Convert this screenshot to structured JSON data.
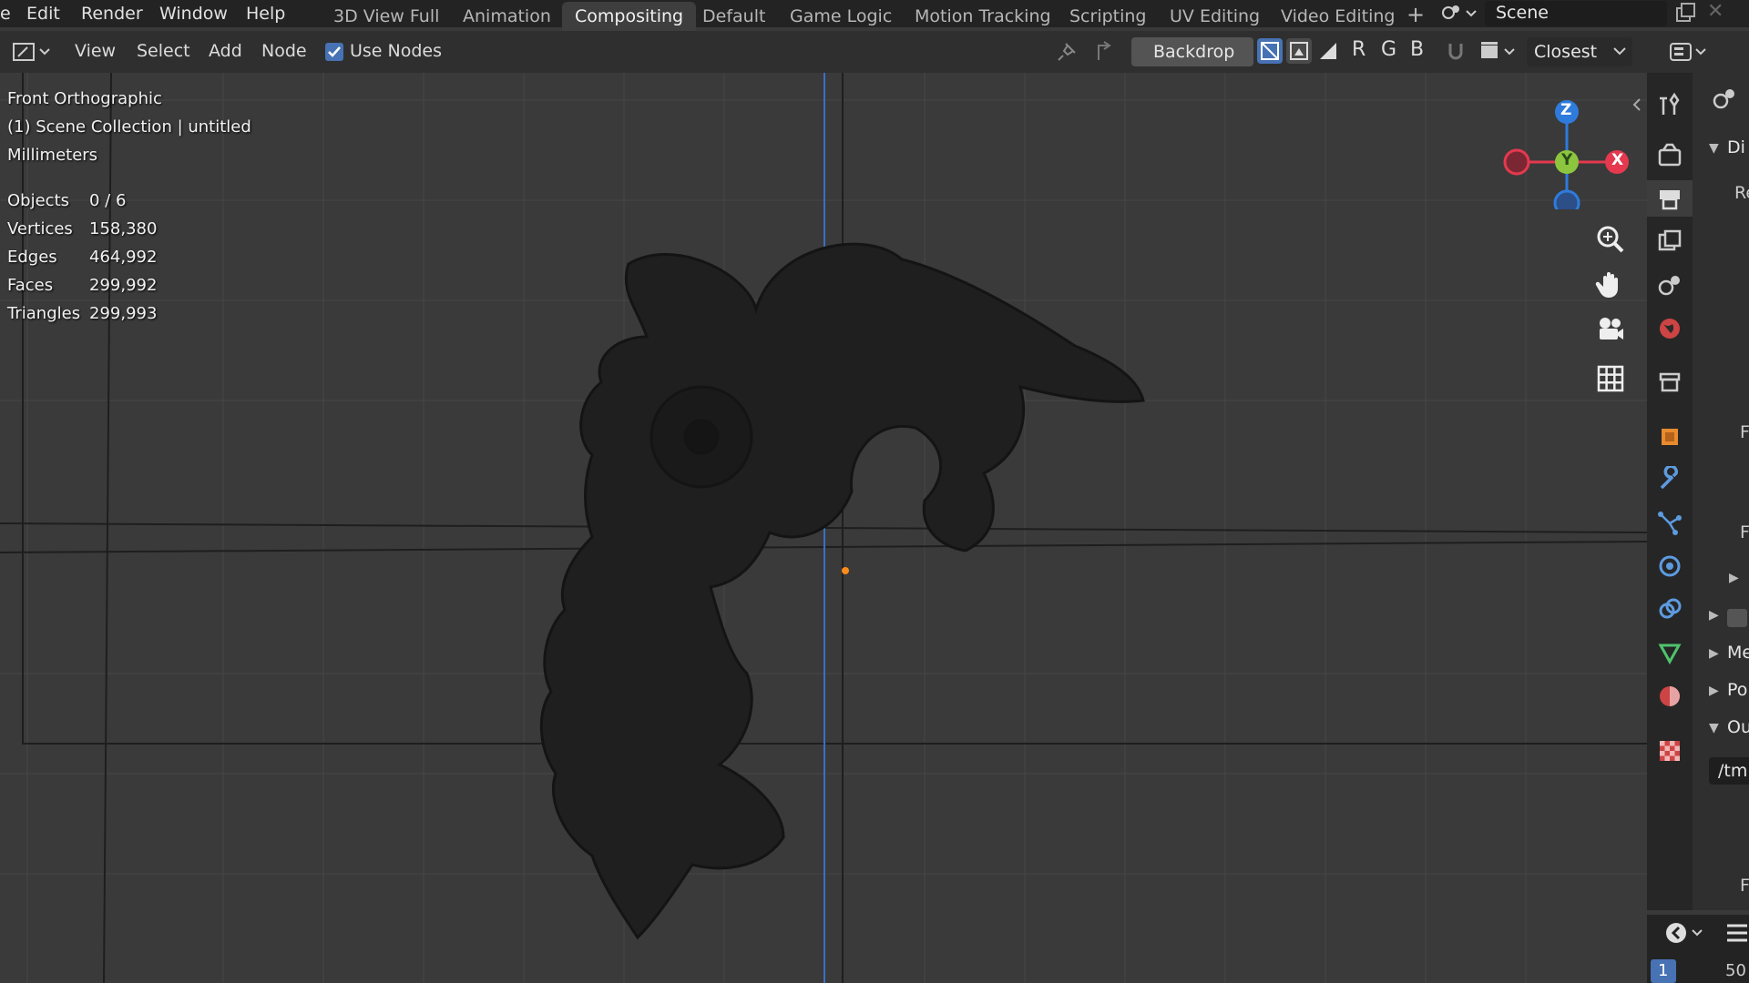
{
  "menu": {
    "edit": "Edit",
    "render": "Render",
    "window": "Window",
    "help": "Help"
  },
  "workspaces": [
    "3D View Full",
    "Animation",
    "Compositing",
    "Default",
    "Game Logic",
    "Motion Tracking",
    "Scripting",
    "UV Editing",
    "Video Editing"
  ],
  "active_workspace": "Compositing",
  "scene_name": "Scene",
  "node_header": {
    "view": "View",
    "select": "Select",
    "add": "Add",
    "node": "Node",
    "use_nodes_label": "Use Nodes",
    "use_nodes_checked": true,
    "backdrop_label": "Backdrop",
    "channels": [
      "R",
      "G",
      "B"
    ],
    "filter_mode": "Closest"
  },
  "viewport": {
    "view_name": "Front Orthographic",
    "collection": "(1) Scene Collection | untitled",
    "units": "Millimeters",
    "stats": [
      {
        "label": "Objects",
        "value": "0 / 6"
      },
      {
        "label": "Vertices",
        "value": "158,380"
      },
      {
        "label": "Edges",
        "value": "464,992"
      },
      {
        "label": "Faces",
        "value": "299,992"
      },
      {
        "label": "Triangles",
        "value": "299,993"
      }
    ],
    "gizmo": {
      "z": "Z",
      "y": "Y",
      "x": "X"
    }
  },
  "properties": {
    "partial_labels": [
      "Di",
      "Re",
      "F",
      "F",
      "Me",
      "Po",
      "Ou",
      "/tmp"
    ],
    "frame_current": "1",
    "frame_partial": "50"
  },
  "colors": {
    "accent": "#4772b3",
    "axis_x": "#e4394e",
    "axis_y": "#8cc63f",
    "axis_z": "#2f7bdc",
    "origin": "#ff8c1a"
  }
}
